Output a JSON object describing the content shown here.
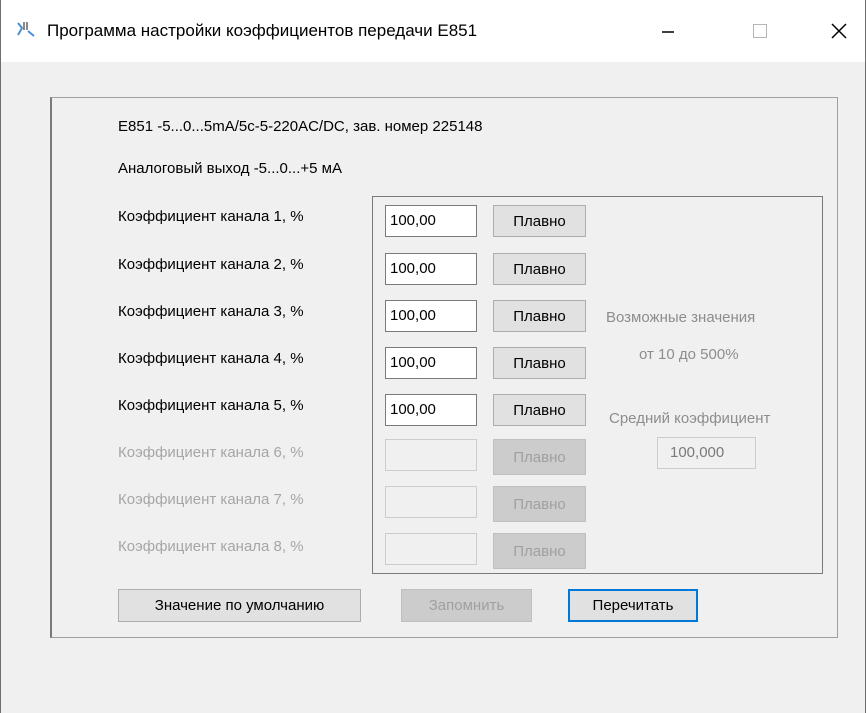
{
  "window": {
    "title": "Программа настройки коэффициентов передачи Е851",
    "icon": "app-icon",
    "controls": [
      "minimize-icon",
      "maximize-icon",
      "close-icon"
    ]
  },
  "device": {
    "info": "Е851 -5...0...5mA/5c-5-220AC/DC, зав. номер 225148",
    "output": "Аналоговый выход -5...0...+5 мА"
  },
  "channels": [
    {
      "label": "Коэффициент канала 1, %",
      "value": "100,00",
      "button": "Плавно",
      "enabled": true
    },
    {
      "label": "Коэффициент канала 2, %",
      "value": "100,00",
      "button": "Плавно",
      "enabled": true
    },
    {
      "label": "Коэффициент канала 3, %",
      "value": "100,00",
      "button": "Плавно",
      "enabled": true
    },
    {
      "label": "Коэффициент канала 4, %",
      "value": "100,00",
      "button": "Плавно",
      "enabled": true
    },
    {
      "label": "Коэффициент канала 5, %",
      "value": "100,00",
      "button": "Плавно",
      "enabled": true
    },
    {
      "label": "Коэффициент канала 6, %",
      "value": "",
      "button": "Плавно",
      "enabled": false
    },
    {
      "label": "Коэффициент канала 7, %",
      "value": "",
      "button": "Плавно",
      "enabled": false
    },
    {
      "label": "Коэффициент канала 8, %",
      "value": "",
      "button": "Плавно",
      "enabled": false
    }
  ],
  "hints": {
    "range_line1": "Возможные значения",
    "range_line2": "от 10 до 500%",
    "avg_label": "Средний коэффициент",
    "avg_value": "100,000"
  },
  "buttons": {
    "default": "Значение по умолчанию",
    "save": "Запомнить",
    "reread": "Перечитать"
  },
  "colors": {
    "focus": "#0078d7",
    "disabled_text": "#a6a6a6",
    "window_bg": "#f0f0f0"
  }
}
